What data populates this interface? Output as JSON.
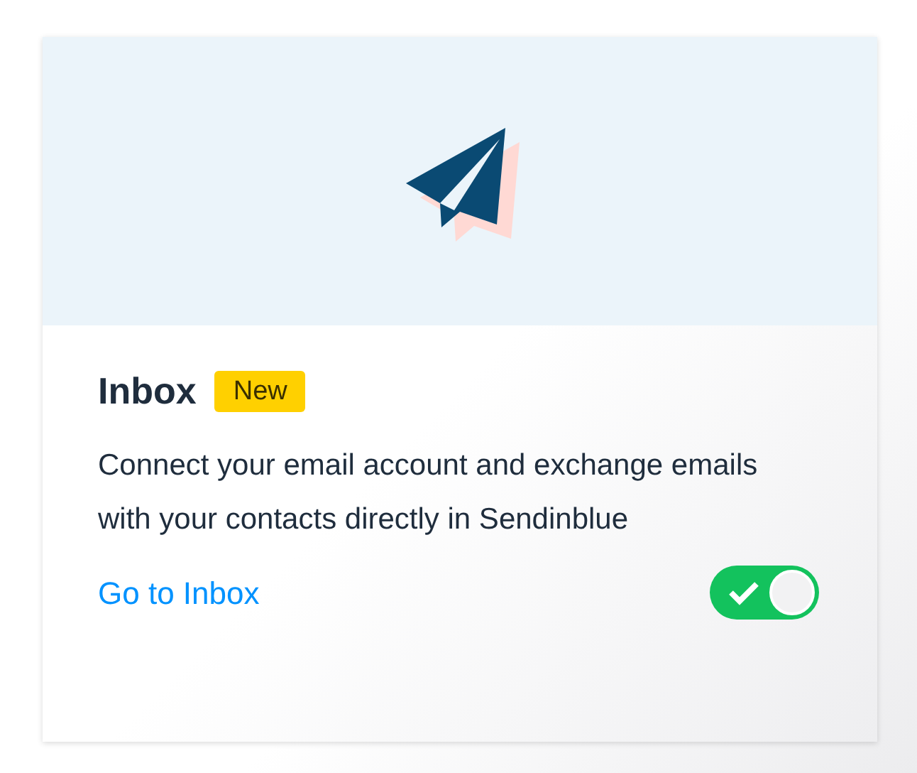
{
  "card": {
    "title": "Inbox",
    "badge": "New",
    "description": "Connect your email account and exchange emails with your contacts directly in Sendinblue",
    "link": "Go to Inbox",
    "toggle": {
      "on": true
    }
  }
}
